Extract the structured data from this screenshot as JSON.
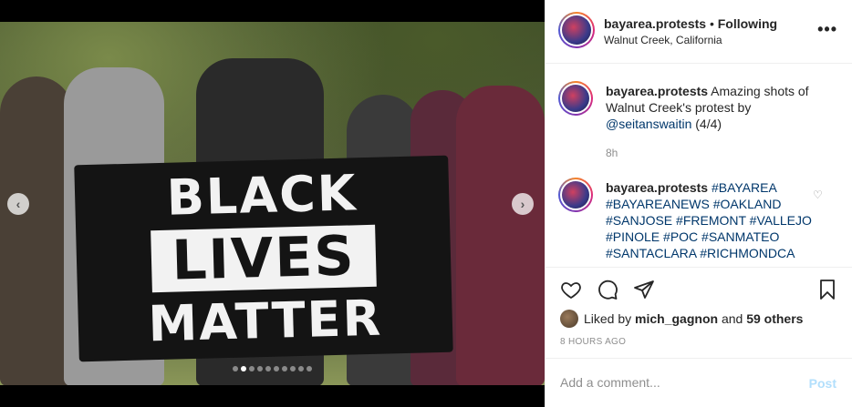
{
  "post": {
    "username": "bayarea.protests",
    "separator": " • ",
    "follow_status": "Following",
    "location": "Walnut Creek, California",
    "more": "•••",
    "banner": [
      "BLACK",
      "LIVES",
      "MATTER"
    ],
    "carousel": {
      "count": 10,
      "active": 1
    }
  },
  "comments": [
    {
      "username": "bayarea.protests",
      "text": " Amazing shots of Walnut Creek's protest by ",
      "mention": "@seitanswaitin",
      "suffix": " (4/4)",
      "time": "8h"
    },
    {
      "username": "bayarea.protests",
      "hashtags": "#BAYAREA #BAYAREANEWS #OAKLAND #SANJOSE #FREMONT #VALLEJO #PINOLE #POC #SANMATEO #SANTACLARA #RICHMONDCA"
    }
  ],
  "likes": {
    "prefix": "Liked by ",
    "user": "mich_gagnon",
    "middle": " and ",
    "others": "59 others"
  },
  "posted_ago": "8 HOURS AGO",
  "add_comment": {
    "placeholder": "Add a comment...",
    "post_label": "Post"
  },
  "colors": {
    "link": "#00376b",
    "muted": "#8e8e8e",
    "post_disabled": "#b2dffc"
  }
}
